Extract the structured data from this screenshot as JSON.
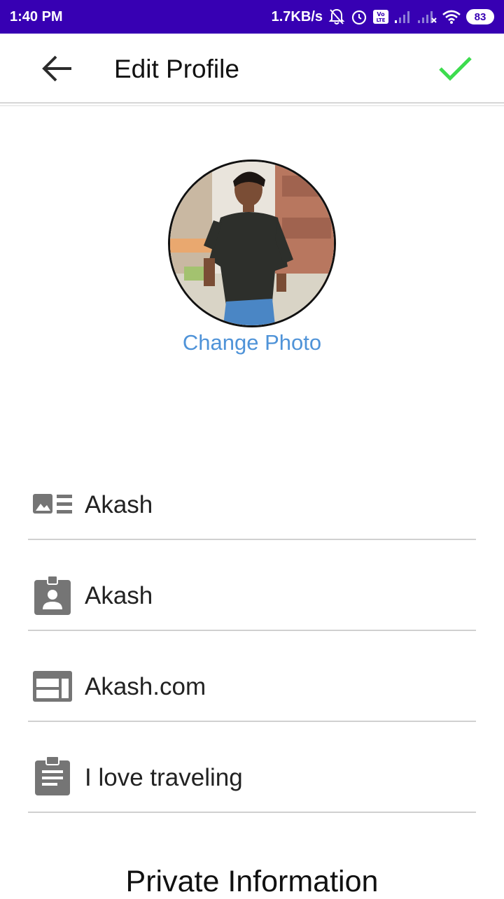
{
  "status_bar": {
    "time": "1:40 PM",
    "speed": "1.7KB/s",
    "battery": "83",
    "icons": [
      "mute-bell-icon",
      "alarm-icon",
      "volte-icon",
      "signal-icon",
      "signal-icon",
      "wifi-icon",
      "battery-icon"
    ]
  },
  "toolbar": {
    "title": "Edit Profile",
    "back_icon": "arrow-left-icon",
    "confirm_icon": "check-icon"
  },
  "profile": {
    "change_photo_label": "Change Photo"
  },
  "fields": [
    {
      "icon": "name-card-icon",
      "value": "Akash"
    },
    {
      "icon": "contact-badge-icon",
      "value": "Akash"
    },
    {
      "icon": "web-icon",
      "value": "Akash.com"
    },
    {
      "icon": "clipboard-icon",
      "value": "I love traveling"
    }
  ],
  "private_section": {
    "title": "Private Information"
  },
  "colors": {
    "status_bar": "#3700b3",
    "accent_link": "#4f93d8",
    "check": "#3ddc4e",
    "icon_grey": "#757575"
  }
}
